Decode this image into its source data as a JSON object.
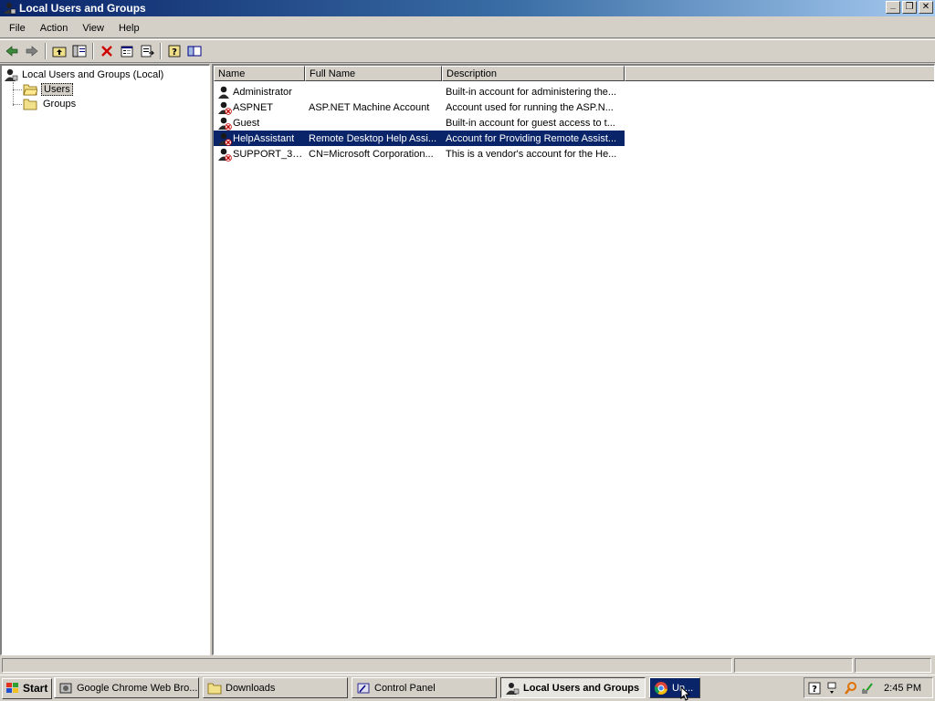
{
  "window": {
    "title": "Local Users and Groups",
    "buttons": {
      "minimize": "_",
      "restore": "❐",
      "close": "✕"
    }
  },
  "menu": {
    "items": [
      {
        "label": "File"
      },
      {
        "label": "Action"
      },
      {
        "label": "View"
      },
      {
        "label": "Help"
      }
    ]
  },
  "toolbar": {
    "buttons": [
      "back-icon",
      "forward-icon",
      "up-folder-icon",
      "show-hide-tree-icon",
      "delete-icon",
      "properties-icon",
      "export-list-icon",
      "help-icon",
      "console-icon"
    ]
  },
  "tree": {
    "root": "Local Users and Groups (Local)",
    "children": [
      {
        "label": "Users",
        "selected": true
      },
      {
        "label": "Groups",
        "selected": false
      }
    ]
  },
  "list": {
    "columns": [
      {
        "label": "Name"
      },
      {
        "label": "Full Name"
      },
      {
        "label": "Description"
      }
    ],
    "rows": [
      {
        "name": "Administrator",
        "full_name": "",
        "description": "Built-in account for administering the...",
        "disabled": false,
        "selected": false
      },
      {
        "name": "ASPNET",
        "full_name": "ASP.NET Machine Account",
        "description": "Account used for running the ASP.N...",
        "disabled": true,
        "selected": false
      },
      {
        "name": "Guest",
        "full_name": "",
        "description": "Built-in account for guest access to t...",
        "disabled": true,
        "selected": false
      },
      {
        "name": "HelpAssistant",
        "full_name": "Remote Desktop Help Assi...",
        "description": "Account for Providing Remote Assist...",
        "disabled": true,
        "selected": true
      },
      {
        "name": "SUPPORT_38...",
        "full_name": "CN=Microsoft Corporation...",
        "description": "This is a vendor's account for the He...",
        "disabled": true,
        "selected": false
      }
    ]
  },
  "taskbar": {
    "start_label": "Start",
    "tasks": [
      {
        "label": "Google Chrome Web Bro...",
        "icon": "chrome-settings-icon",
        "active": false
      },
      {
        "label": "Downloads",
        "icon": "folder-icon",
        "active": false
      },
      {
        "label": "Control Panel",
        "icon": "control-panel-icon",
        "active": false
      },
      {
        "label": "Local Users and Groups",
        "icon": "users-icon",
        "active": true
      },
      {
        "label": "Un...",
        "icon": "chrome-icon",
        "active": false
      }
    ],
    "clock": "2:45 PM"
  },
  "colors": {
    "selection": "#0a246a",
    "chrome": "#d4d0c8",
    "title_gradient_start": "#0a246a",
    "title_gradient_end": "#a6caf0"
  }
}
